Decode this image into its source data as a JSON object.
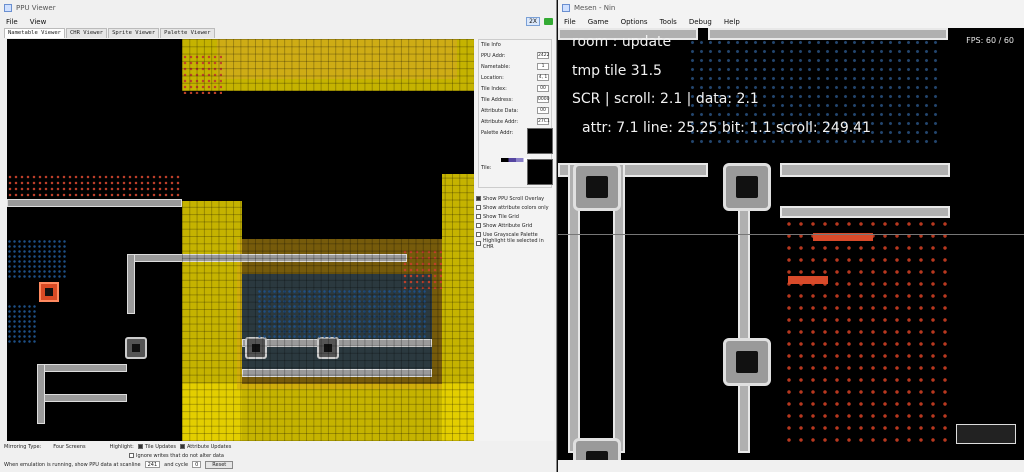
{
  "ppu_window": {
    "title": "PPU Viewer",
    "menu": [
      "File",
      "View"
    ],
    "zoom": "2X",
    "tabs": [
      "Nametable Viewer",
      "CHR Viewer",
      "Sprite Viewer",
      "Palette Viewer"
    ],
    "tile_info": {
      "header": "Tile Info",
      "fields": [
        {
          "label": "PPU Addr:",
          "value": "2422"
        },
        {
          "label": "Nametable:",
          "value": "1"
        },
        {
          "label": "Location:",
          "value": "4, 1"
        },
        {
          "label": "Tile Index:",
          "value": "00"
        },
        {
          "label": "Tile Address:",
          "value": "0000"
        },
        {
          "label": "Attribute Data:",
          "value": "00"
        },
        {
          "label": "Attribute Addr:",
          "value": "27C1"
        },
        {
          "label": "Palette Addr:",
          "value": ""
        }
      ],
      "tile_label": "Tile:",
      "checkboxes": [
        {
          "label": "Show PPU Scroll Overlay",
          "checked": true
        },
        {
          "label": "Show attribute colors only",
          "checked": false
        },
        {
          "label": "Show Tile Grid",
          "checked": false
        },
        {
          "label": "Show Attribute Grid",
          "checked": false
        },
        {
          "label": "Use Grayscale Palette",
          "checked": false
        },
        {
          "label": "Highlight tile selected in CHR",
          "checked": false
        }
      ]
    },
    "bottom": {
      "mirroring_label": "Mirroring Type:",
      "mirroring_value": "Four Screens",
      "highlight_label": "Highlight:",
      "tile_updates": "Tile Updates",
      "attribute_updates": "Attribute Updates",
      "ignore_writes": "Ignore writes that do not alter data",
      "refresh_note": "When emulation is running, show PPU data at scanline",
      "scanline": "241",
      "and_cycle": "and cycle",
      "cycle": "0",
      "reset": "Reset"
    }
  },
  "game_window": {
    "title": "Mesen - Nin",
    "menu": [
      "File",
      "Game",
      "Options",
      "Tools",
      "Debug",
      "Help"
    ],
    "overlay": {
      "line1": "room : update",
      "line2": "tmp tile 31.5",
      "line3": "SCR  | scroll: 2.1 | data: 2.1",
      "line4": "attr: 7.1  line: 25.25  bit: 1.1  scroll: 249.41",
      "fps": "FPS: 60 / 60"
    }
  },
  "colors": {
    "highlight_yellow": "#e8d200",
    "water": "#243545",
    "rust": "#c0402a",
    "pipe": "#a0a0a0",
    "accent_orange": "#d94a24"
  }
}
